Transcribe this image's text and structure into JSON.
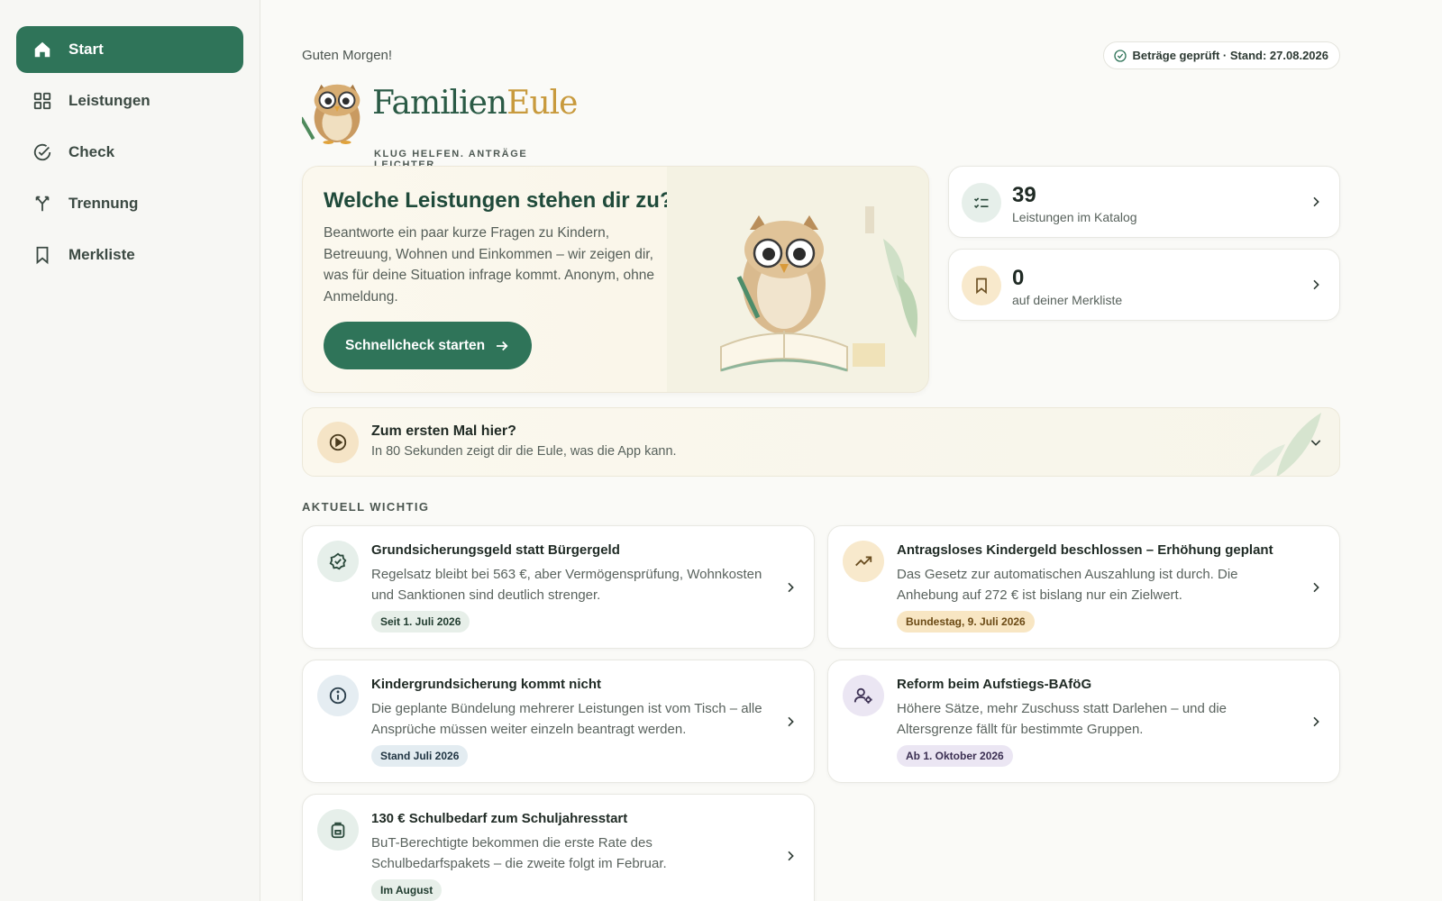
{
  "sidebar": {
    "items": [
      {
        "label": "Start",
        "icon": "home-icon",
        "active": true
      },
      {
        "label": "Leistungen",
        "icon": "grid-icon"
      },
      {
        "label": "Check",
        "icon": "check-circle-icon"
      },
      {
        "label": "Trennung",
        "icon": "split-icon"
      },
      {
        "label": "Merkliste",
        "icon": "bookmark-icon"
      }
    ]
  },
  "header": {
    "greeting": "Guten Morgen!",
    "status": "Beträge geprüft · Stand: 27.08.2026"
  },
  "logo": {
    "name_part1": "Familien",
    "name_part2": "Eule",
    "tagline": "KLUG HELFEN. ANTRÄGE LEICHTER."
  },
  "hero": {
    "title": "Welche Leistungen stehen dir zu?",
    "text": "Beantworte ein paar kurze Fragen zu Kindern, Betreuung, Wohnen und Einkommen – wir zeigen dir, was für deine Situation infrage kommt. Anonym, ohne Anmeldung.",
    "cta": "Schnellcheck starten"
  },
  "stats": [
    {
      "value": "39",
      "label": "Leistungen im Katalog",
      "icon": "checklist-icon"
    },
    {
      "value": "0",
      "label": "auf deiner Merkliste",
      "icon": "bookmark-icon"
    }
  ],
  "intro": {
    "title": "Zum ersten Mal hier?",
    "subtitle": "In 80 Sekunden zeigt dir die Eule, was die App kann."
  },
  "section_title": "AKTUELL WICHTIG",
  "news": [
    {
      "title": "Grundsicherungsgeld statt Bürgergeld",
      "text": "Regelsatz bleibt bei 563 €, aber Vermögensprüfung, Wohnkosten und Sanktionen sind deutlich strenger.",
      "tag": "Seit 1. Juli 2026",
      "icon": "badge-check-icon"
    },
    {
      "title": "Antragsloses Kindergeld beschlossen – Erhöhung geplant",
      "text": "Das Gesetz zur automatischen Auszahlung ist durch. Die Anhebung auf 272 € ist bislang nur ein Zielwert.",
      "tag": "Bundestag, 9. Juli 2026",
      "icon": "trending-up-icon"
    },
    {
      "title": "Kindergrundsicherung kommt nicht",
      "text": "Die geplante Bündelung mehrerer Leistungen ist vom Tisch – alle Ansprüche müssen weiter einzeln beantragt werden.",
      "tag": "Stand Juli 2026",
      "icon": "info-icon"
    },
    {
      "title": "Reform beim Aufstiegs-BAföG",
      "text": "Höhere Sätze, mehr Zuschuss statt Darlehen – und die Altersgrenze fällt für bestimmte Gruppen.",
      "tag": "Ab 1. Oktober 2026",
      "icon": "user-cog-icon"
    },
    {
      "title": "130 € Schulbedarf zum Schuljahresstart",
      "text": "BuT-Berechtigte bekommen die erste Rate des Schulbedarfspakets – die zweite folgt im Februar.",
      "tag": "Im August",
      "icon": "backpack-icon"
    }
  ],
  "colors": {
    "accent": "#2f7459",
    "gold": "#c89a3d"
  }
}
